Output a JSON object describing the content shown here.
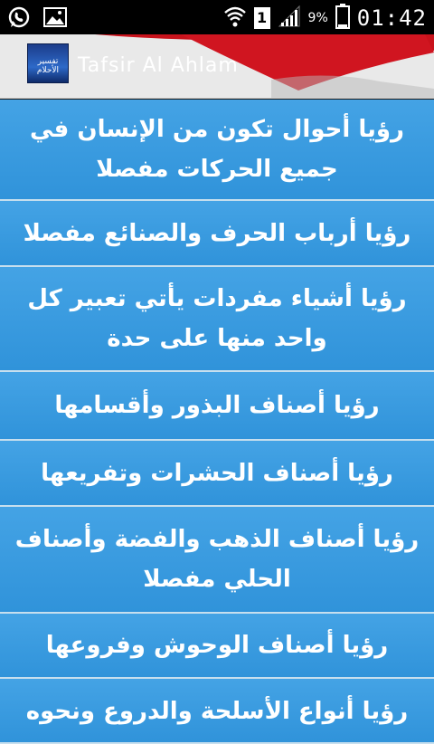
{
  "status_bar": {
    "battery": "9%",
    "time": "01:42",
    "sim": "1"
  },
  "app": {
    "title": "Tafsir Al Ahlam",
    "icon_text": "تفسير الأحلام"
  },
  "list": {
    "items": [
      {
        "label": "رؤيا أحوال تكون من الإنسان في جميع الحركات مفصلا"
      },
      {
        "label": "رؤيا أرباب الحرف والصنائع مفصلا"
      },
      {
        "label": "رؤيا أشياء مفردات يأتي تعبير كل واحد منها على حدة"
      },
      {
        "label": "رؤيا أصناف البذور وأقسامها"
      },
      {
        "label": "رؤيا أصناف الحشرات وتفريعها"
      },
      {
        "label": "رؤيا أصناف الذهب والفضة وأصناف الحلي مفصلا"
      },
      {
        "label": "رؤيا أصناف الوحوش وفروعها"
      },
      {
        "label": "رؤيا أنواع الأسلحة والدروع ونحوه"
      }
    ]
  },
  "colors": {
    "item_bg": "#3a9be0",
    "divider": "#c7dfee",
    "swoosh": "#c8121b"
  }
}
